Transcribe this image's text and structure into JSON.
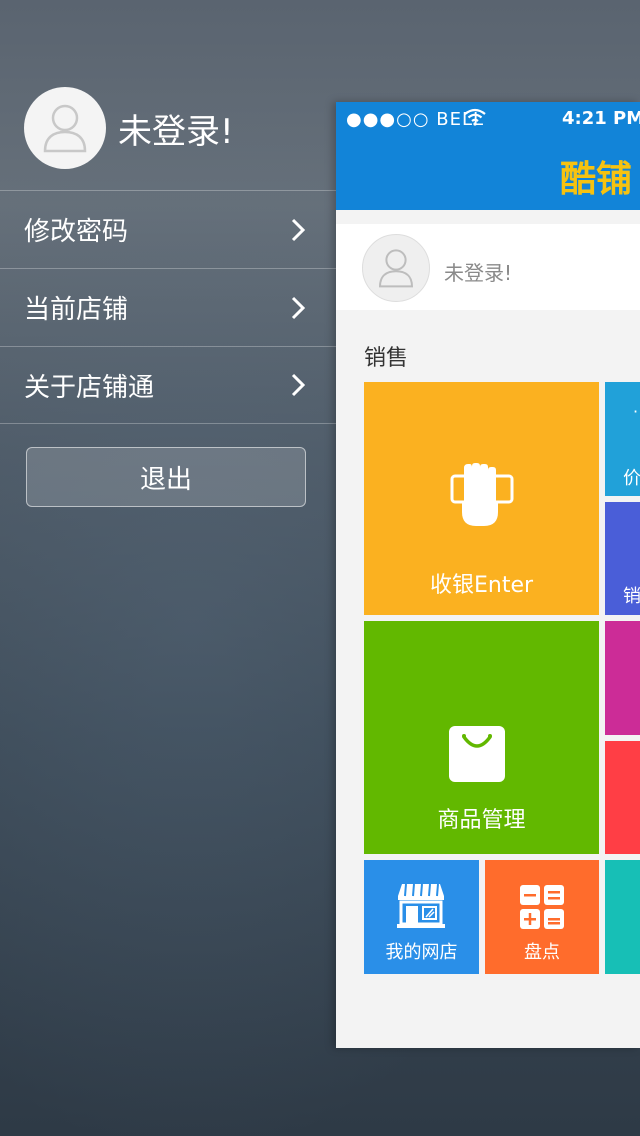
{
  "menu": {
    "username": "未登录!",
    "items": [
      {
        "label": "修改密码"
      },
      {
        "label": "当前店铺"
      },
      {
        "label": "关于店铺通"
      }
    ],
    "logout_label": "退出"
  },
  "status_bar": {
    "signal": "●●●○○ BELL",
    "time": "4:21 PM"
  },
  "app": {
    "title": "酷铺",
    "profile_name": "未登录!",
    "section_title": "销售",
    "tiles": {
      "cashier": "收银Enter",
      "goods": "商品管理",
      "shop": "我的网店",
      "stock": "盘点",
      "price_partial": "价",
      "sales_partial": "销"
    }
  },
  "colors": {
    "nav_blue": "#1284d8",
    "title_yellow": "#f6c210",
    "tile_orange": "#fbb120",
    "tile_green": "#62b800",
    "tile_blue": "#2a8fe8",
    "tile_deep_orange": "#ff6c2c",
    "tile_cyan": "#21a1d9",
    "tile_indigo": "#4a5ed8",
    "tile_magenta": "#cc2c97",
    "tile_red": "#ff3e45",
    "tile_teal": "#17bfb6"
  },
  "icons": [
    "user-avatar-icon",
    "chevron-right-icon",
    "wifi-icon",
    "cash-hand-icon",
    "shopping-bag-icon",
    "storefront-icon",
    "calculator-icon"
  ]
}
